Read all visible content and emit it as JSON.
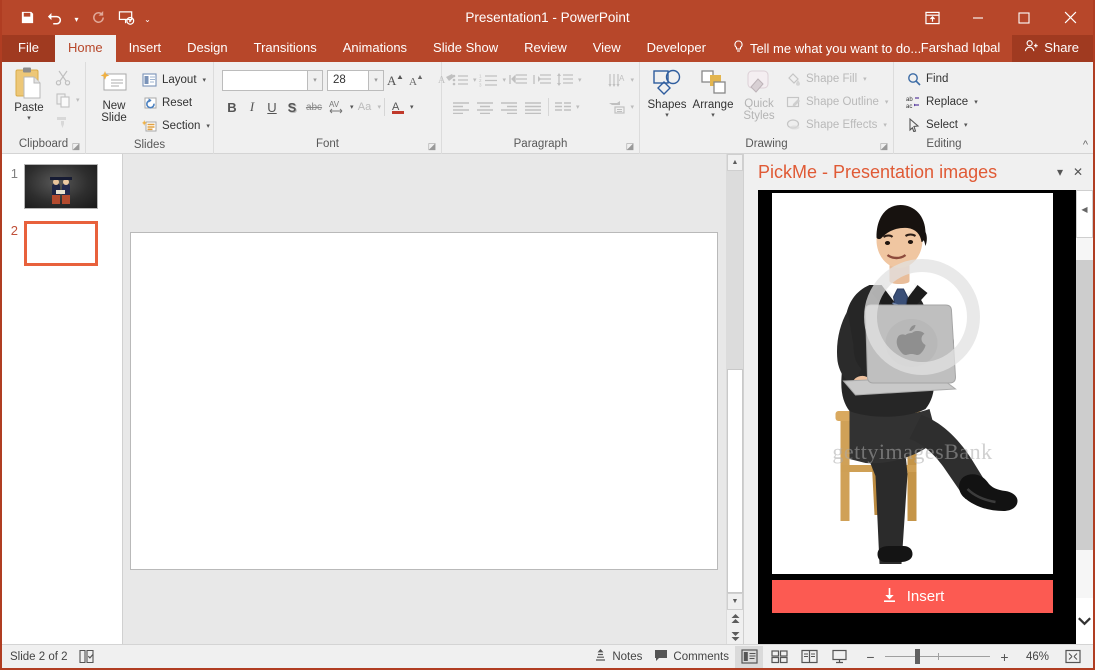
{
  "titlebar": {
    "title": "Presentation1 - PowerPoint",
    "qat": [
      {
        "name": "save-icon",
        "label": "Save"
      },
      {
        "name": "undo-icon",
        "label": "Undo"
      },
      {
        "name": "redo-icon",
        "label": "Redo"
      },
      {
        "name": "start-presentation-icon",
        "label": "Start From Beginning"
      },
      {
        "name": "customize-qat-icon",
        "label": "Customize Quick Access Toolbar"
      }
    ],
    "window_controls": [
      {
        "name": "ribbon-display-options-icon",
        "label": "Ribbon Display Options"
      },
      {
        "name": "minimize-icon",
        "label": "Minimize"
      },
      {
        "name": "maximize-icon",
        "label": "Restore Down"
      },
      {
        "name": "close-icon",
        "label": "Close"
      }
    ]
  },
  "tabs": [
    {
      "label": "File",
      "active": false,
      "file": true
    },
    {
      "label": "Home",
      "active": true
    },
    {
      "label": "Insert",
      "active": false
    },
    {
      "label": "Design",
      "active": false
    },
    {
      "label": "Transitions",
      "active": false
    },
    {
      "label": "Animations",
      "active": false
    },
    {
      "label": "Slide Show",
      "active": false
    },
    {
      "label": "Review",
      "active": false
    },
    {
      "label": "View",
      "active": false
    },
    {
      "label": "Developer",
      "active": false
    }
  ],
  "tellme": "Tell me what you want to do...",
  "account": {
    "user": "Farshad Iqbal",
    "share_label": "Share"
  },
  "ribbon": {
    "collapse_label": "^",
    "groups": [
      {
        "name": "clipboard",
        "label": "Clipboard",
        "paste_label": "Paste",
        "cut_label": "Cut",
        "copy_label": "Copy",
        "format_painter_label": "Format Painter"
      },
      {
        "name": "slides",
        "label": "Slides",
        "new_slide_label": "New\nSlide",
        "new_slide_line1": "New",
        "new_slide_line2": "Slide",
        "items": [
          {
            "label": "Layout",
            "icon": "layout-icon"
          },
          {
            "label": "Reset",
            "icon": "reset-icon"
          },
          {
            "label": "Section",
            "icon": "section-icon"
          }
        ]
      },
      {
        "name": "font",
        "label": "Font",
        "font_name_value": "",
        "font_name_placeholder": "",
        "font_size_value": "28",
        "buttons": [
          {
            "label": "Increase Font Size",
            "icon": "increase-font-icon"
          },
          {
            "label": "Decrease Font Size",
            "icon": "decrease-font-icon"
          },
          {
            "label": "Clear All Formatting",
            "icon": "clear-formatting-icon"
          },
          {
            "label": "Bold",
            "icon": "bold-icon",
            "glyph": "B"
          },
          {
            "label": "Italic",
            "icon": "italic-icon",
            "glyph": "I"
          },
          {
            "label": "Underline",
            "icon": "underline-icon",
            "glyph": "U"
          },
          {
            "label": "Text Shadow",
            "icon": "text-shadow-icon",
            "glyph": "S"
          },
          {
            "label": "Strikethrough",
            "icon": "strikethrough-icon",
            "glyph": "abc"
          },
          {
            "label": "Character Spacing",
            "icon": "character-spacing-icon",
            "glyph": "AV"
          },
          {
            "label": "Change Case",
            "icon": "change-case-icon",
            "glyph": "Aa"
          },
          {
            "label": "Font Color",
            "icon": "font-color-icon",
            "glyph": "A"
          }
        ]
      },
      {
        "name": "paragraph",
        "label": "Paragraph",
        "buttons": [
          {
            "label": "Bullets",
            "icon": "bullets-icon"
          },
          {
            "label": "Numbering",
            "icon": "numbering-icon"
          },
          {
            "label": "Decrease List Level",
            "icon": "decrease-indent-icon"
          },
          {
            "label": "Increase List Level",
            "icon": "increase-indent-icon"
          },
          {
            "label": "Line Spacing",
            "icon": "line-spacing-icon"
          },
          {
            "label": "Text Direction",
            "icon": "text-direction-icon"
          },
          {
            "label": "Align Left",
            "icon": "align-left-icon"
          },
          {
            "label": "Center",
            "icon": "align-center-icon"
          },
          {
            "label": "Align Right",
            "icon": "align-right-icon"
          },
          {
            "label": "Justify",
            "icon": "justify-icon"
          },
          {
            "label": "Columns",
            "icon": "columns-icon"
          },
          {
            "label": "Align Text",
            "icon": "align-text-icon"
          },
          {
            "label": "Convert to SmartArt",
            "icon": "smartart-icon"
          }
        ]
      },
      {
        "name": "drawing",
        "label": "Drawing",
        "shapes_label": "Shapes",
        "arrange_label": "Arrange",
        "quick_styles_line1": "Quick",
        "quick_styles_line2": "Styles",
        "items": [
          {
            "label": "Shape Fill",
            "icon": "shape-fill-icon"
          },
          {
            "label": "Shape Outline",
            "icon": "shape-outline-icon"
          },
          {
            "label": "Shape Effects",
            "icon": "shape-effects-icon"
          }
        ]
      },
      {
        "name": "editing",
        "label": "Editing",
        "items": [
          {
            "label": "Find",
            "icon": "find-icon"
          },
          {
            "label": "Replace",
            "icon": "replace-icon"
          },
          {
            "label": "Select",
            "icon": "select-icon"
          }
        ]
      }
    ]
  },
  "slides_panel": {
    "slides": [
      {
        "number": "1",
        "selected": false,
        "kind": "graduation-photo"
      },
      {
        "number": "2",
        "selected": true,
        "kind": "blank"
      }
    ]
  },
  "canvas": {
    "scroll": {
      "up_label": "▲",
      "down_label": "▼",
      "previous_slide_label": "Previous Slide",
      "next_slide_label": "Next Slide"
    }
  },
  "pickme_panel": {
    "title": "PickMe - Presentation images",
    "menu_label": "▾",
    "close_label": "✕",
    "image": {
      "name": "businessman-with-laptop-photo",
      "watermark": "gettyimagesBank",
      "alt": "Businessman in black suit sitting on a wooden stool using a laptop"
    },
    "insert_label": "Insert",
    "insert_color": "#fc5a52",
    "scroll_up_label": "◀",
    "scroll_down_label": "⌄"
  },
  "statusbar": {
    "slide_indicator": "Slide 2 of 2",
    "accessibility_label": "Accessibility Checker",
    "notes_label": "Notes",
    "comments_label": "Comments",
    "views": [
      {
        "name": "normal-view-button",
        "label": "Normal",
        "active": true
      },
      {
        "name": "slide-sorter-button",
        "label": "Slide Sorter",
        "active": false
      },
      {
        "name": "reading-view-button",
        "label": "Reading View",
        "active": false
      },
      {
        "name": "slide-show-button",
        "label": "Slide Show",
        "active": false
      }
    ],
    "zoom": {
      "out_label": "−",
      "in_label": "+",
      "value": "46%",
      "fit_label": "Fit slide to current window"
    }
  }
}
